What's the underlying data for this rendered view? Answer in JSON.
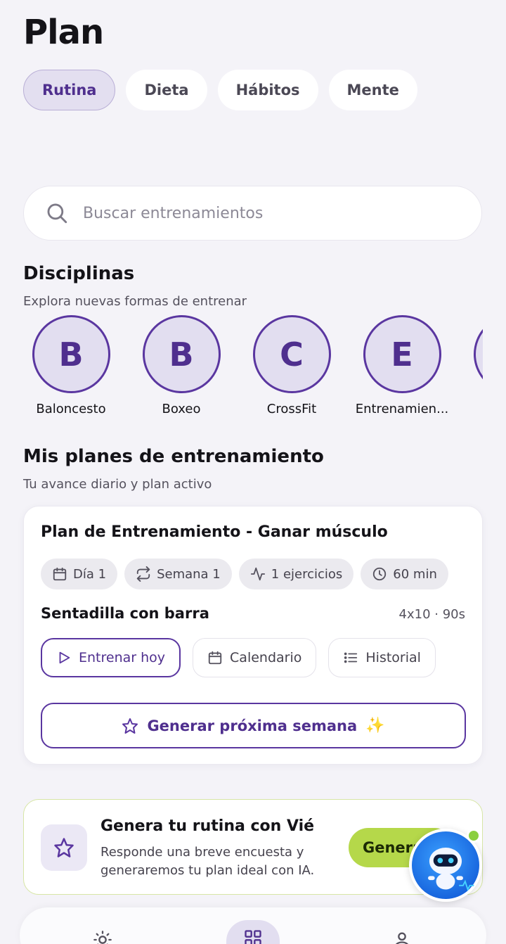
{
  "header": {
    "title": "Plan"
  },
  "tabs": [
    {
      "label": "Rutina",
      "active": true
    },
    {
      "label": "Dieta",
      "active": false
    },
    {
      "label": "Hábitos",
      "active": false
    },
    {
      "label": "Mente",
      "active": false
    }
  ],
  "search": {
    "placeholder": "Buscar entrenamientos",
    "icon": "search-icon"
  },
  "disciplines": {
    "title": "Disciplinas",
    "subtitle": "Explora nuevas formas de entrenar",
    "items": [
      {
        "letter": "B",
        "label": "Baloncesto"
      },
      {
        "letter": "B",
        "label": "Boxeo"
      },
      {
        "letter": "C",
        "label": "CrossFit"
      },
      {
        "letter": "E",
        "label": "Entrenamien..."
      }
    ]
  },
  "plans": {
    "title": "Mis planes de entrenamiento",
    "subtitle": "Tu avance diario y plan activo",
    "card": {
      "name": "Plan de Entrenamiento - Ganar músculo",
      "chips": [
        {
          "icon": "calendar-icon",
          "label": "Día 1"
        },
        {
          "icon": "repeat-icon",
          "label": "Semana 1"
        },
        {
          "icon": "activity-icon",
          "label": "1 ejercicios"
        },
        {
          "icon": "clock-icon",
          "label": "60 min"
        }
      ],
      "exercise": {
        "name": "Sentadilla con barra",
        "meta": "4x10 · 90s"
      },
      "actions": {
        "train": "Entrenar hoy",
        "calendar": "Calendario",
        "history": "Historial"
      },
      "generate_label": "Generar próxima semana",
      "generate_emoji": "✨"
    }
  },
  "ai_card": {
    "title": "Genera tu rutina con Vié",
    "description": "Responde una breve encuesta y generaremos tu plan ideal con IA.",
    "button": "Generar"
  },
  "colors": {
    "accent": "#5a36a0",
    "accent_light": "#e2def0",
    "lime": "#b5d84a",
    "background": "#f4f3f8"
  },
  "bottom_nav": [
    {
      "icon": "sun-icon",
      "active": false
    },
    {
      "icon": "grid-icon",
      "active": true
    },
    {
      "icon": "user-icon",
      "active": false
    }
  ]
}
